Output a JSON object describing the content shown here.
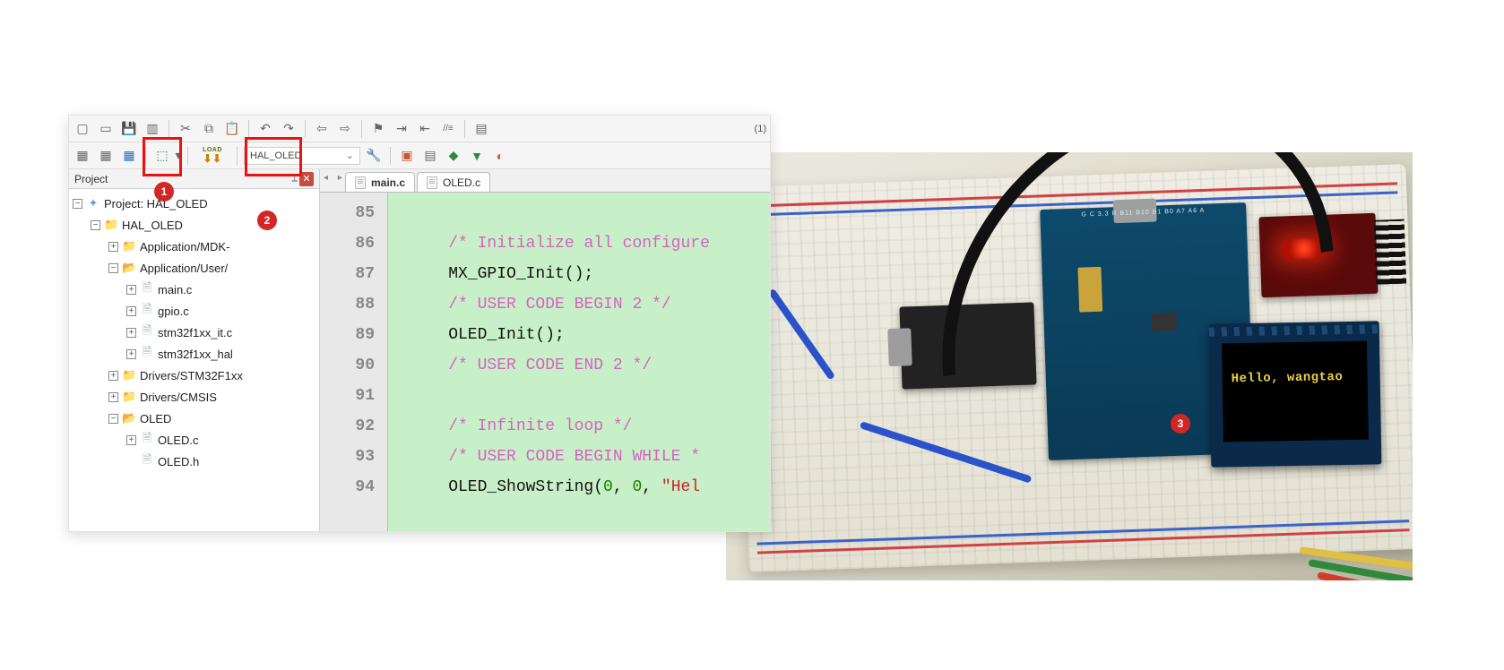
{
  "toolbar": {
    "target_name": "HAL_OLED",
    "extra_number": "(1)"
  },
  "panels": {
    "project_title": "Project"
  },
  "annotations": {
    "badge1": "1",
    "badge2": "2",
    "badge3": "3"
  },
  "tree": {
    "root": "Project: HAL_OLED",
    "target": "HAL_OLED",
    "folders": [
      "Application/MDK-",
      "Application/User/",
      "Drivers/STM32F1xx",
      "Drivers/CMSIS",
      "OLED"
    ],
    "user_files": [
      "main.c",
      "gpio.c",
      "stm32f1xx_it.c",
      "stm32f1xx_hal"
    ],
    "oled_files": [
      "OLED.c",
      "OLED.h"
    ]
  },
  "tabs": {
    "active": "main.c",
    "other": "OLED.c"
  },
  "code": {
    "lines": [
      {
        "n": 85,
        "segs": []
      },
      {
        "n": 86,
        "segs": [
          {
            "t": "    ",
            "c": ""
          },
          {
            "t": "/* Initialize all configure",
            "c": "c-comment"
          }
        ]
      },
      {
        "n": 87,
        "segs": [
          {
            "t": "    MX_GPIO_Init();",
            "c": "c-func"
          }
        ]
      },
      {
        "n": 88,
        "segs": [
          {
            "t": "    ",
            "c": ""
          },
          {
            "t": "/* USER CODE BEGIN 2 */",
            "c": "c-comment"
          }
        ]
      },
      {
        "n": 89,
        "segs": [
          {
            "t": "    OLED_Init();",
            "c": "c-func"
          }
        ]
      },
      {
        "n": 90,
        "segs": [
          {
            "t": "    ",
            "c": ""
          },
          {
            "t": "/* USER CODE END 2 */",
            "c": "c-comment"
          }
        ]
      },
      {
        "n": 91,
        "segs": []
      },
      {
        "n": 92,
        "segs": [
          {
            "t": "    ",
            "c": ""
          },
          {
            "t": "/* Infinite loop */",
            "c": "c-comment"
          }
        ]
      },
      {
        "n": 93,
        "segs": [
          {
            "t": "    ",
            "c": ""
          },
          {
            "t": "/* USER CODE BEGIN WHILE *",
            "c": "c-comment"
          }
        ]
      },
      {
        "n": 94,
        "segs": [
          {
            "t": "    OLED_ShowString(",
            "c": "c-func"
          },
          {
            "t": "0",
            "c": "c-num"
          },
          {
            "t": ", ",
            "c": "c-func"
          },
          {
            "t": "0",
            "c": "c-num"
          },
          {
            "t": ", ",
            "c": "c-func"
          },
          {
            "t": "\"Hel",
            "c": "c-str"
          }
        ]
      }
    ]
  },
  "hardware": {
    "mcu_label": "G C 3.3 R B11 B10 B1 B0 A7 A6 A",
    "oled_text": "Hello, wangtao"
  },
  "icons": {
    "load_label": "LOAD"
  }
}
